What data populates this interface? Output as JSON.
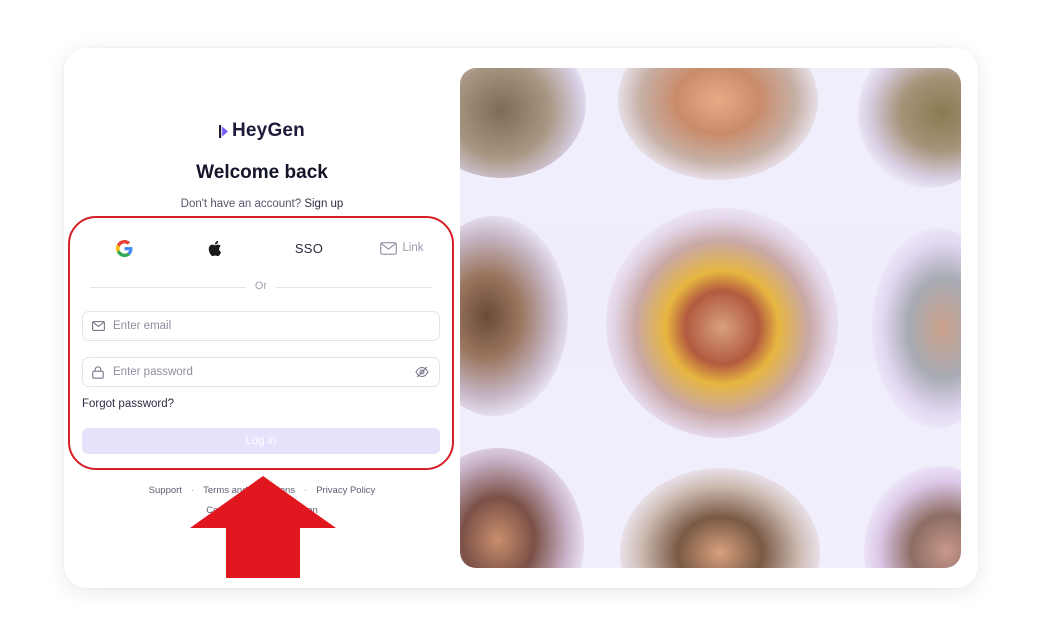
{
  "brand": {
    "name": "HeyGen"
  },
  "login": {
    "title": "Welcome back",
    "signup_prompt": "Don't have an account?",
    "signup_link": "Sign up",
    "providers": {
      "google": "google-icon",
      "apple": "apple-icon",
      "sso_label": "SSO",
      "link_label": "Link"
    },
    "divider_label": "Or",
    "email_placeholder": "Enter email",
    "password_placeholder": "Enter password",
    "forgot_label": "Forgot password?",
    "login_label": "Log in"
  },
  "footer": {
    "support": "Support",
    "terms": "Terms and Conditions",
    "privacy": "Privacy Policy",
    "separator": "·",
    "copyright": "Copyright © 2024 HeyGen"
  },
  "colors": {
    "accent": "#7559ff",
    "login_button_bg": "#e6e2fb",
    "annotation_red": "#d61f26",
    "panel_bg": "#f1eefc"
  }
}
